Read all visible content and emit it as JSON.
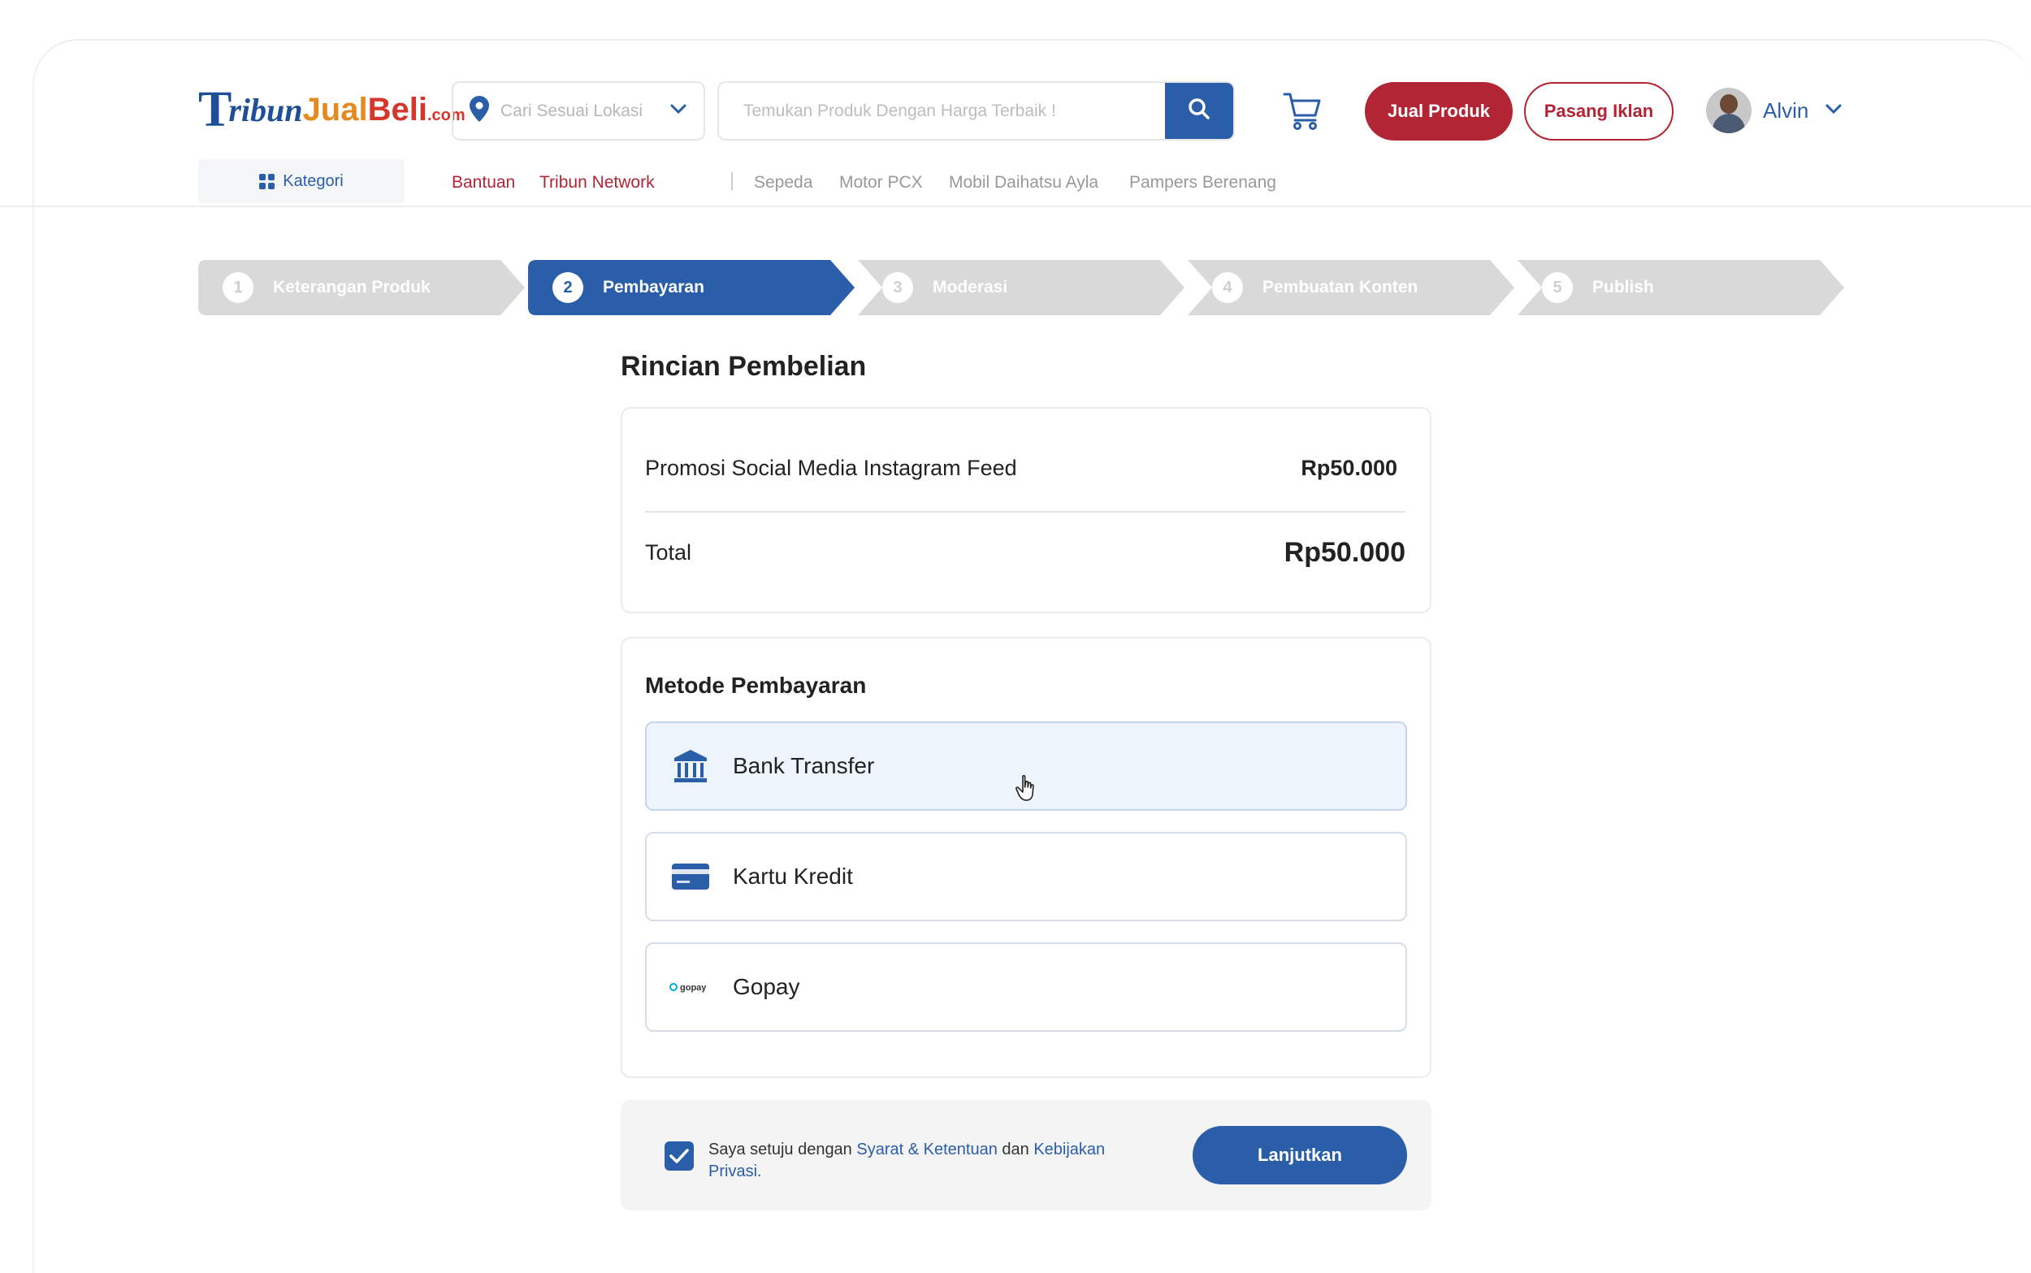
{
  "header": {
    "logo": {
      "t": "T",
      "ribun": "ribun",
      "jual": "Jual",
      "beli": "Beli",
      "com": ".com"
    },
    "location_placeholder": "Cari Sesuai Lokasi",
    "search_placeholder": "Temukan Produk Dengan Harga Terbaik !",
    "jual_produk": "Jual Produk",
    "pasang_iklan": "Pasang Iklan",
    "user_name": "Alvin",
    "kategori": "Kategori",
    "nav": [
      "Bantuan",
      "Tribun Network"
    ],
    "tags": [
      "Sepeda",
      "Motor PCX",
      "Mobil Daihatsu Ayla",
      "Pampers Berenang"
    ]
  },
  "steps": [
    {
      "num": "1",
      "label": "Keterangan Produk",
      "active": false
    },
    {
      "num": "2",
      "label": "Pembayaran",
      "active": true
    },
    {
      "num": "3",
      "label": "Moderasi",
      "active": false
    },
    {
      "num": "4",
      "label": "Pembuatan Konten",
      "active": false
    },
    {
      "num": "5",
      "label": "Publish",
      "active": false
    }
  ],
  "summary": {
    "title": "Rincian Pembelian",
    "item_name": "Promosi Social Media Instagram Feed",
    "item_price": "Rp50.000",
    "total_label": "Total",
    "total_value": "Rp50.000"
  },
  "payment": {
    "title": "Metode Pembayaran",
    "methods": [
      {
        "label": "Bank Transfer",
        "icon": "bank-icon",
        "selected": true
      },
      {
        "label": "Kartu Kredit",
        "icon": "credit-card-icon",
        "selected": false
      },
      {
        "label": "Gopay",
        "icon": "gopay-logo",
        "selected": false
      }
    ],
    "gopay_logo_text": "gopay"
  },
  "agreement": {
    "prefix": "Saya setuju dengan ",
    "terms": "Syarat & Ketentuan",
    "middle": " dan ",
    "privacy": "Kebijakan Privasi",
    "suffix": "."
  },
  "continue_label": "Lanjutkan",
  "colors": {
    "primary": "#2a5ea9",
    "brand_red": "#b22535",
    "step_inactive": "#d9d9d9"
  }
}
